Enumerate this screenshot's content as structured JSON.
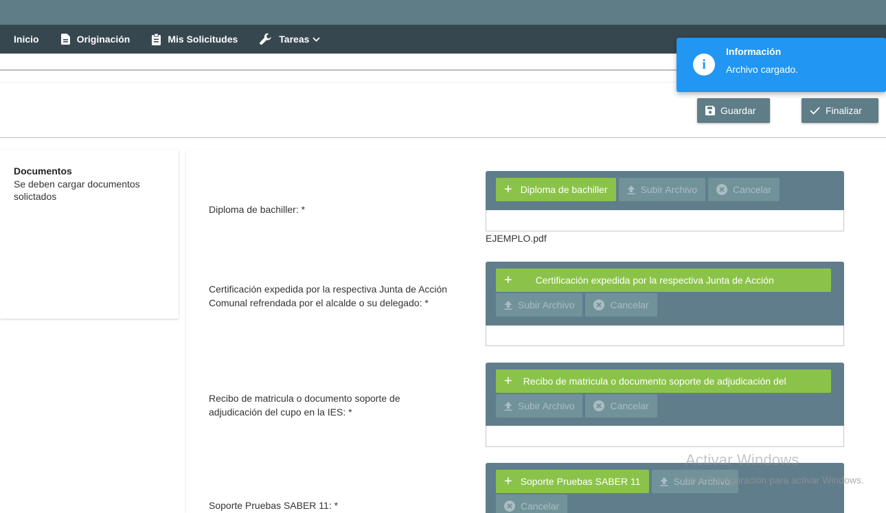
{
  "nav": {
    "items": [
      {
        "label": "Inicio"
      },
      {
        "label": "Originación",
        "icon": "file-icon"
      },
      {
        "label": "Mis Solicitudes",
        "icon": "clipboard-icon"
      },
      {
        "label": "Tareas",
        "icon": "wrench-icon"
      }
    ]
  },
  "toolbar": {
    "save_label": "Guardar",
    "finish_label": "Finalizar"
  },
  "toast": {
    "title": "Información",
    "message": "Archivo cargado."
  },
  "sidebar": {
    "title": "Documentos",
    "description": "Se deben cargar documentos solictados"
  },
  "documents": [
    {
      "label": "Diploma de bachiller: *",
      "choose_label": "Diploma de bachiller",
      "upload_label": "Subir Archivo",
      "cancel_label": "Cancelar",
      "file": "EJEMPLO.pdf"
    },
    {
      "label": "Certificación expedida por la respectiva Junta de Acción Comunal refrendada por el alcalde o su delegado: *",
      "choose_label": "Certificación expedida por la respectiva Junta de Acción",
      "upload_label": "Subir Archivo",
      "cancel_label": "Cancelar"
    },
    {
      "label": "Recibo de matricula o documento soporte de adjudicación del cupo en la IES: *",
      "choose_label": "Recibo de matricula o documento soporte de adjudicación del",
      "upload_label": "Subir Archivo",
      "cancel_label": "Cancelar"
    },
    {
      "label": "Soporte Pruebas SABER 11: *",
      "choose_label": "Soporte Pruebas SABER 11",
      "upload_label": "Subir Archivo",
      "cancel_label": "Cancelar"
    }
  ],
  "watermark": {
    "title": "Activar Windows",
    "subtitle": "Ve a Configuración para activar Windows."
  },
  "colors": {
    "navbar": "#37474f",
    "accent": "#607d8b",
    "choose_button": "#8bc34a",
    "toast": "#2196f3"
  }
}
